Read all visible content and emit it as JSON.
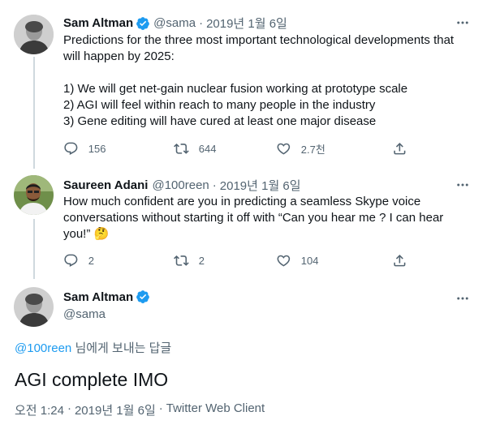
{
  "colors": {
    "accent": "#1d9bf0",
    "text_primary": "#0f1419",
    "text_secondary": "#536471",
    "thread_line": "#cfd9de"
  },
  "tweets": [
    {
      "name": "Sam Altman",
      "handle": "@sama",
      "separator": "·",
      "date": "2019년 1월 6일",
      "text": "Predictions for the three most important technological developments that will happen by 2025:\n\n1) We will get net-gain nuclear fusion working at prototype scale\n2) AGI will feel within reach to many people in the industry\n3) Gene editing will have cured at least one major disease",
      "replies": "156",
      "retweets": "644",
      "likes": "2.7천"
    },
    {
      "name": "Saureen Adani",
      "handle": "@100reen",
      "separator": "·",
      "date": "2019년 1월 6일",
      "text": "How much confident are you in predicting a seamless Skype voice conversations without starting it off with “Can you hear me ? I can hear you!” 🤔",
      "replies": "2",
      "retweets": "2",
      "likes": "104"
    }
  ],
  "main_tweet": {
    "name": "Sam Altman",
    "handle": "@sama",
    "reply_mention": "@100reen",
    "reply_suffix": " 님에게 보내는 답글",
    "text": "AGI complete IMO",
    "time": "오전 1:24",
    "date": "2019년 1월 6일",
    "client": "Twitter Web Client",
    "separator": "·"
  },
  "icons": {
    "verified": "verified-badge-icon",
    "more": "more-dots-icon",
    "reply": "reply-bubble-icon",
    "retweet": "retweet-icon",
    "like": "heart-icon",
    "share": "share-icon"
  }
}
